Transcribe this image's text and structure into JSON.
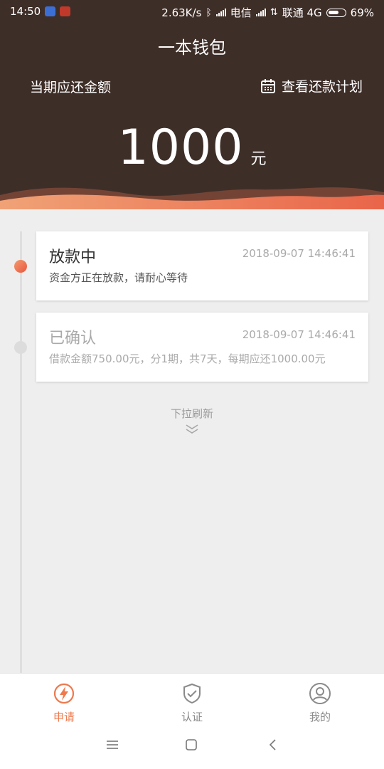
{
  "status_bar": {
    "time": "14:50",
    "network_speed": "2.63K/s",
    "carrier1": "电信",
    "carrier2": "联通 4G",
    "battery": "69%",
    "battery_level": 0.69
  },
  "header": {
    "title": "一本钱包",
    "period_label": "当期应还金额",
    "plan_link": "查看还款计划",
    "amount": "1000",
    "unit": "元"
  },
  "timeline": [
    {
      "title": "放款中",
      "time": "2018-09-07 14:46:41",
      "desc": "资金方正在放款，请耐心等待",
      "active": true
    },
    {
      "title": "已确认",
      "time": "2018-09-07 14:46:41",
      "desc": "借款金额750.00元，分1期，共7天，每期应还1000.00元",
      "active": false
    }
  ],
  "pull_hint": "下拉刷新",
  "tabs": [
    {
      "label": "申请",
      "icon": "lightning-icon",
      "active": true
    },
    {
      "label": "认证",
      "icon": "shield-check-icon",
      "active": false
    },
    {
      "label": "我的",
      "icon": "user-icon",
      "active": false
    }
  ],
  "colors": {
    "header_bg": "#3e2e28",
    "accent": "#ee7a4e",
    "page_bg": "#eeeeee"
  }
}
